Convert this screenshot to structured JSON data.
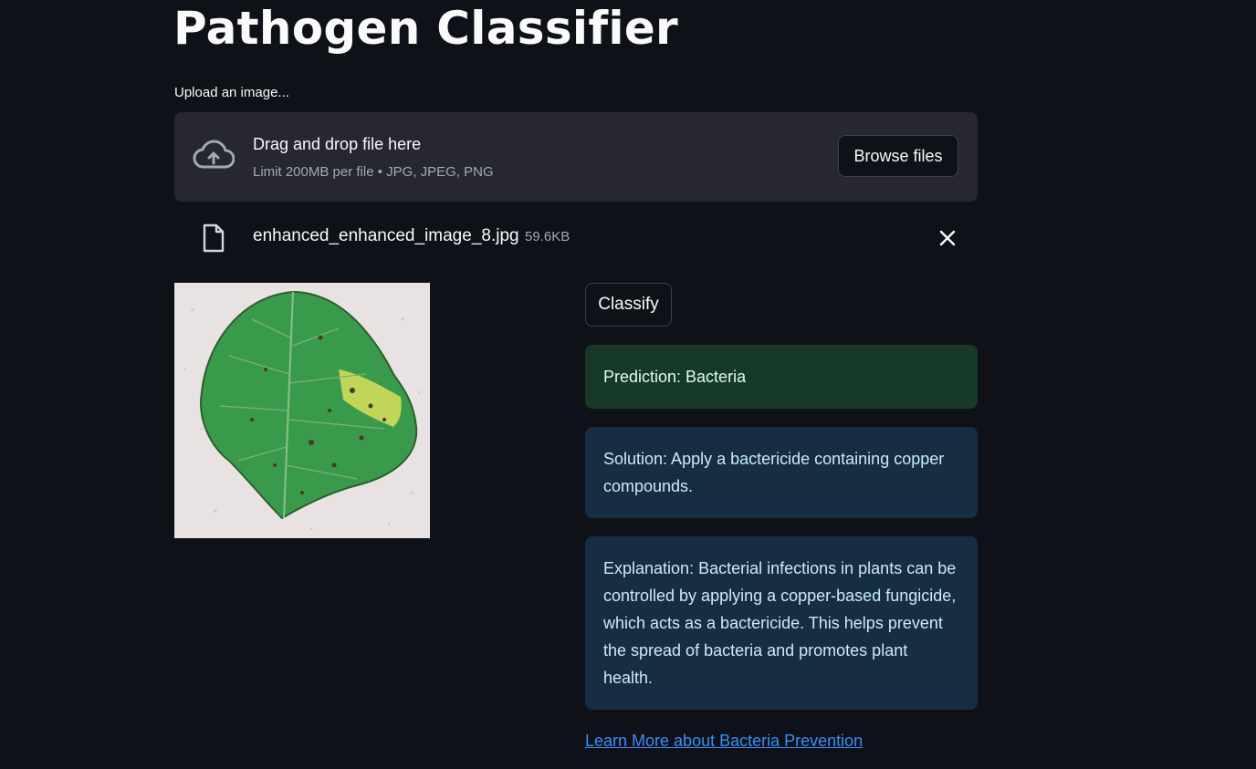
{
  "page": {
    "title": "Pathogen Classifier"
  },
  "uploader": {
    "label": "Upload an image...",
    "drop_text": "Drag and drop file here",
    "limit_text": "Limit 200MB per file • JPG, JPEG, PNG",
    "browse_label": "Browse files"
  },
  "file": {
    "name": "enhanced_enhanced_image_8.jpg",
    "size": "59.6KB"
  },
  "actions": {
    "classify_label": "Classify"
  },
  "results": {
    "prediction": "Prediction: Bacteria",
    "solution": "Solution: Apply a bactericide containing copper compounds.",
    "explanation": "Explanation: Bacterial infections in plants can be controlled by applying a copper-based fungicide, which acts as a bactericide. This helps prevent the spread of bacteria and promotes plant health.",
    "link_text": "Learn More about Bacteria Prevention"
  },
  "colors": {
    "background": "#0e1117",
    "dropzone": "#262730",
    "success_bg": "#173928",
    "info_bg": "#172d43",
    "link": "#3c8ef7"
  },
  "icons": {
    "upload": "cloud-upload-icon",
    "file": "file-icon",
    "remove": "close-icon"
  }
}
